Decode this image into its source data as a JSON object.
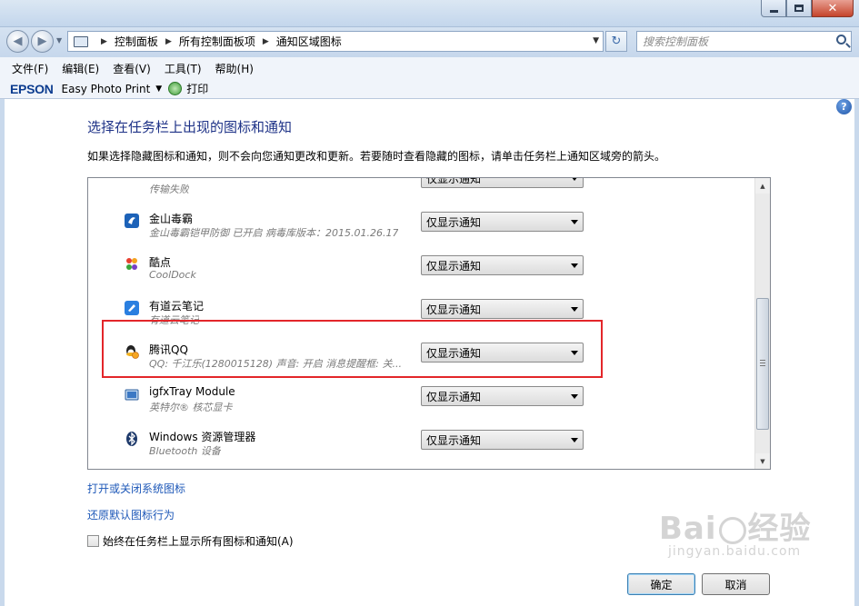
{
  "window": {
    "close_glyph": "✕"
  },
  "address": {
    "crumbs": [
      "控制面板",
      "所有控制面板项",
      "通知区域图标"
    ],
    "search_placeholder": "搜索控制面板"
  },
  "menu": [
    "文件(F)",
    "编辑(E)",
    "查看(V)",
    "工具(T)",
    "帮助(H)"
  ],
  "epson": {
    "logo": "EPSON",
    "app": "Easy Photo Print",
    "print": "打印"
  },
  "page": {
    "title": "选择在任务栏上出现的图标和通知",
    "description": "如果选择隐藏图标和通知，则不会向您通知更改和更新。若要随时查看隐藏的图标，请单击任务栏上通知区域旁的箭头。"
  },
  "rows": [
    {
      "name": "",
      "sub": "传输失败",
      "behavior": "仅显示通知",
      "icon": "transfer-icon"
    },
    {
      "name": "金山毒霸",
      "sub": "金山毒霸铠甲防御 已开启 病毒库版本：2015.01.26.17",
      "behavior": "仅显示通知",
      "icon": "kingsoft-antivirus-icon"
    },
    {
      "name": "酷点",
      "sub": "CoolDock",
      "behavior": "仅显示通知",
      "icon": "cooldock-icon"
    },
    {
      "name": "有道云笔记",
      "sub": "有道云笔记",
      "behavior": "仅显示通知",
      "icon": "youdao-note-icon"
    },
    {
      "name": "腾讯QQ",
      "sub": "QQ: 千江乐(1280015128)  声音: 开启  消息提醒框: 关...",
      "behavior": "仅显示通知",
      "icon": "qq-penguin-icon"
    },
    {
      "name": "igfxTray Module",
      "sub": "英特尔® 核芯显卡",
      "behavior": "仅显示通知",
      "icon": "intel-graphics-icon"
    },
    {
      "name": "Windows 资源管理器",
      "sub": "Bluetooth 设备",
      "behavior": "仅显示通知",
      "icon": "bluetooth-icon"
    }
  ],
  "links": {
    "system_icons": "打开或关闭系统图标",
    "restore_default": "还原默认图标行为"
  },
  "always_show": {
    "label": "始终在任务栏上显示所有图标和通知(A)",
    "checked": false
  },
  "buttons": {
    "ok": "确定",
    "cancel": "取消"
  },
  "watermark": {
    "brand": "Bai",
    "brand_tail": "经验",
    "site": "jingyan.baidu.com"
  },
  "colors": {
    "title_blue": "#1e3287",
    "link_blue": "#1e58b8",
    "highlight_red": "#e3262a"
  }
}
